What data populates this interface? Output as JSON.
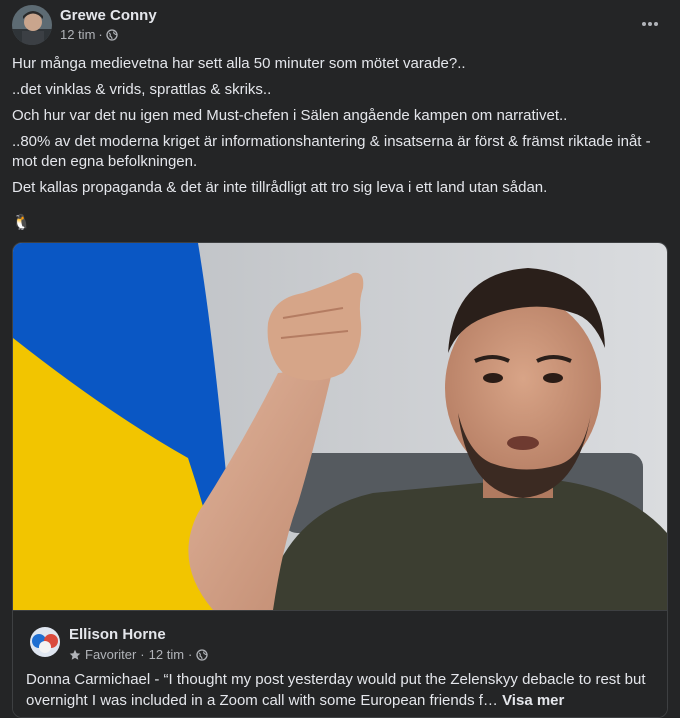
{
  "post": {
    "author": "Grewe Conny",
    "time": "12 tim",
    "separator": "·",
    "paragraphs": [
      "Hur många medievetna har sett alla 50 minuter som mötet varade?..",
      "..det vinklas & vrids, sprattlas & skriks..",
      "Och hur var det nu igen med Must-chefen i Sälen angående kampen om narrativet..",
      "..80% av det moderna kriget är informationshantering & insatserna är först & främst riktade inåt - mot den egna befolkningen.",
      "Det kallas propaganda & det är inte tillrådligt att tro sig leva i ett land utan sådan."
    ],
    "emoji": "🐧"
  },
  "shared": {
    "author": "Ellison Horne",
    "audience": "Favoriter",
    "time": "12 tim",
    "separator": "·",
    "text": "Donna Carmichael - “I thought my post yesterday would put the Zelenskyy debacle to rest but overnight I was included in a Zoom call with some European friends f…",
    "see_more": "Visa mer"
  },
  "colors": {
    "background": "#242526",
    "text_primary": "#e4e6eb",
    "text_secondary": "#b0b3b8",
    "flag_blue": "#0a57c4",
    "flag_yellow": "#f2c500"
  }
}
